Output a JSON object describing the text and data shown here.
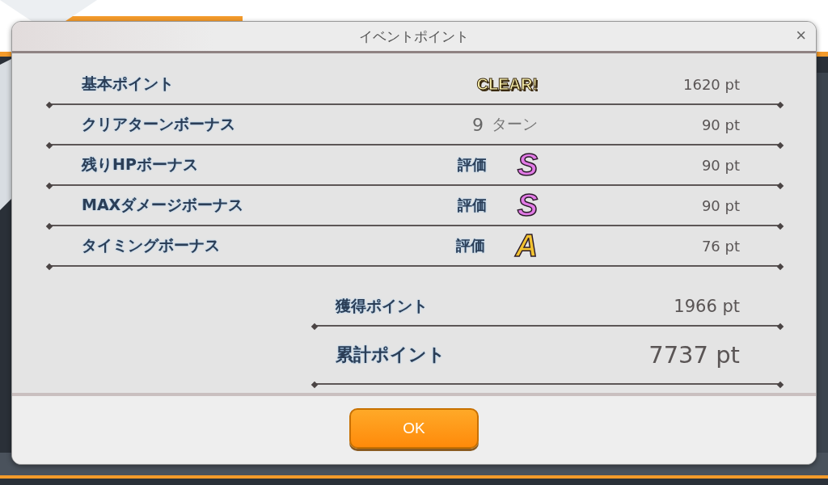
{
  "dialog": {
    "title": "イベントポイント",
    "close": "×",
    "rows": [
      {
        "label": "基本ポイント",
        "kind": "badge",
        "badge": "CLEAR!",
        "points": "1620 pt"
      },
      {
        "label": "クリアターンボーナス",
        "kind": "turns",
        "turns": "9",
        "unit": "ターン",
        "points": "90 pt"
      },
      {
        "label": "残りHPボーナス",
        "kind": "grade",
        "caption": "評価",
        "grade": "S",
        "color": "#e27ae6",
        "points": "90 pt"
      },
      {
        "label": "MAXダメージボーナス",
        "kind": "grade",
        "caption": "評価",
        "grade": "S",
        "color": "#e27ae6",
        "points": "90 pt"
      },
      {
        "label": "タイミングボーナス",
        "kind": "grade",
        "caption": "評価",
        "grade": "A",
        "color": "#f2c230",
        "points": "76 pt"
      }
    ],
    "totals": [
      {
        "label": "獲得ポイント",
        "kind": "earned",
        "value": "1966 pt"
      },
      {
        "label": "累計ポイント",
        "kind": "total",
        "value": "7737 pt"
      }
    ],
    "button": "OK"
  }
}
